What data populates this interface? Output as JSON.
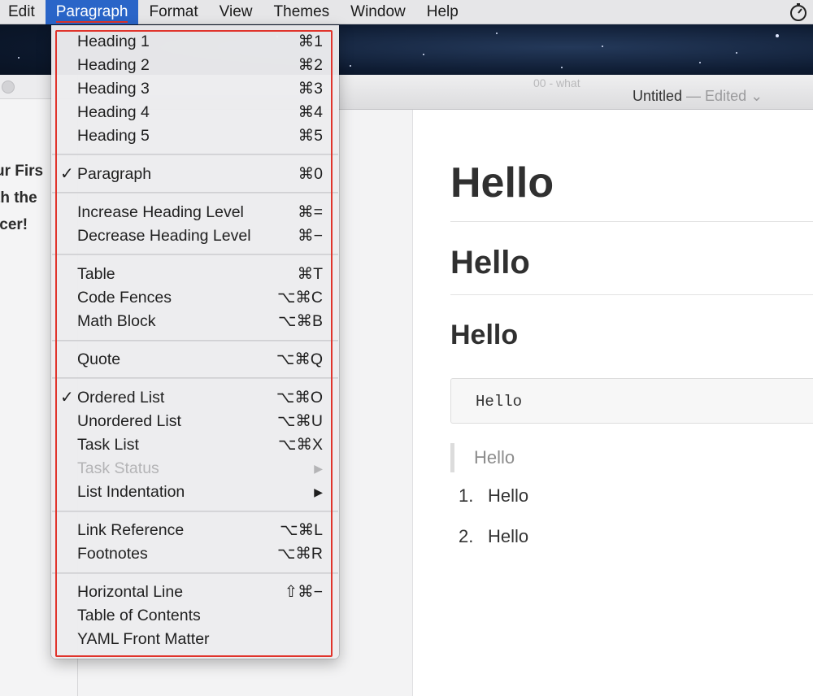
{
  "menubar": {
    "items": [
      "Edit",
      "Paragraph",
      "Format",
      "View",
      "Themes",
      "Window",
      "Help"
    ],
    "active": "Paragraph"
  },
  "timer_icon": "stopwatch-icon",
  "sidebar": {
    "lines": [
      "ur Firs",
      "th the",
      "icer!"
    ]
  },
  "editor": {
    "faint_title": "00 - what",
    "title": "Untitled",
    "title_sep": " — ",
    "status": "Edited",
    "status_chevron": "⌄",
    "content": {
      "h1": "Hello",
      "h2": "Hello",
      "h3": "Hello",
      "code": "Hello",
      "quote": "Hello",
      "list": [
        {
          "num": "1.",
          "text": "Hello"
        },
        {
          "num": "2.",
          "text": "Hello"
        }
      ]
    }
  },
  "paragraph_menu": {
    "groups": [
      [
        {
          "label": "Heading 1",
          "shortcut": "⌘1"
        },
        {
          "label": "Heading 2",
          "shortcut": "⌘2"
        },
        {
          "label": "Heading 3",
          "shortcut": "⌘3"
        },
        {
          "label": "Heading 4",
          "shortcut": "⌘4"
        },
        {
          "label": "Heading 5",
          "shortcut": "⌘5"
        }
      ],
      [
        {
          "label": "Paragraph",
          "shortcut": "⌘0",
          "checked": true
        }
      ],
      [
        {
          "label": "Increase Heading Level",
          "shortcut": "⌘="
        },
        {
          "label": "Decrease Heading Level",
          "shortcut": "⌘−"
        }
      ],
      [
        {
          "label": "Table",
          "shortcut": "⌘T"
        },
        {
          "label": "Code Fences",
          "shortcut": "⌥⌘C"
        },
        {
          "label": "Math Block",
          "shortcut": "⌥⌘B"
        }
      ],
      [
        {
          "label": "Quote",
          "shortcut": "⌥⌘Q"
        }
      ],
      [
        {
          "label": "Ordered List",
          "shortcut": "⌥⌘O",
          "checked": true
        },
        {
          "label": "Unordered List",
          "shortcut": "⌥⌘U"
        },
        {
          "label": "Task List",
          "shortcut": "⌥⌘X"
        },
        {
          "label": "Task Status",
          "submenu": true,
          "disabled": true
        },
        {
          "label": "List Indentation",
          "submenu": true
        }
      ],
      [
        {
          "label": "Link Reference",
          "shortcut": "⌥⌘L"
        },
        {
          "label": "Footnotes",
          "shortcut": "⌥⌘R"
        }
      ],
      [
        {
          "label": "Horizontal Line",
          "shortcut": "⇧⌘−"
        },
        {
          "label": "Table of Contents"
        },
        {
          "label": "YAML Front Matter"
        }
      ]
    ],
    "check_glyph": "✓",
    "submenu_glyph": "▶"
  },
  "colors": {
    "highlight_outline": "#e0342c",
    "menu_active": "#2a65c8"
  }
}
